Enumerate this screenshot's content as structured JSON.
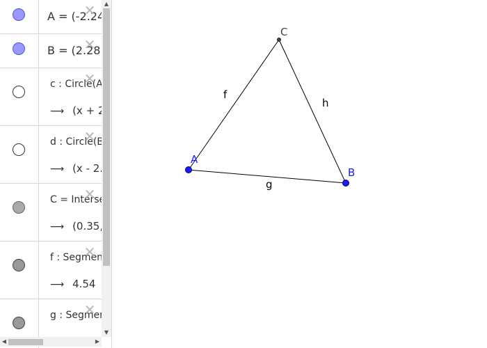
{
  "algebra": {
    "rows": [
      {
        "definition": "A = (-2.24",
        "marble_color": "#9999ff"
      },
      {
        "definition": "B = (2.28",
        "marble_color": "#9999ff"
      },
      {
        "definition": "c : Circle(A",
        "output": "(x + 2.",
        "marble_color": "#ffffff"
      },
      {
        "definition": "d : Circle(B",
        "output": "(x - 2.2",
        "marble_color": "#ffffff"
      },
      {
        "definition": "C = Intersec",
        "output": "(0.35,",
        "marble_color": "#aaaaaa"
      },
      {
        "definition": "f : Segmen",
        "output": "4.54",
        "marble_color": "#999999"
      },
      {
        "definition": "g : Segmen",
        "marble_color": "#999999"
      }
    ],
    "arrow_glyph": "⟶",
    "close_glyph": "✕"
  },
  "graphics": {
    "points": [
      {
        "label": "A",
        "color": "#1a1aff"
      },
      {
        "label": "B",
        "color": "#1a1aff"
      },
      {
        "label": "C",
        "color": "#444444"
      }
    ],
    "segments": [
      {
        "label": "f"
      },
      {
        "label": "g"
      },
      {
        "label": "h"
      }
    ]
  }
}
